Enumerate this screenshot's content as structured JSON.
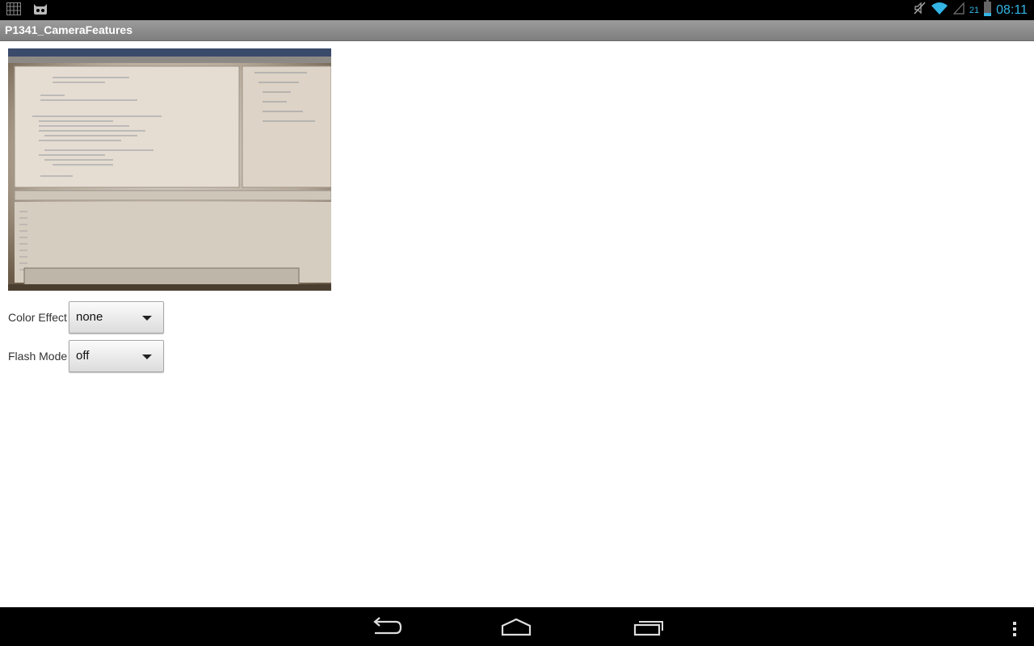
{
  "status_bar": {
    "icons_left": [
      "keyboard-grid-icon",
      "cyanogen-android-icon"
    ],
    "icons_right": [
      "mute-icon",
      "wifi-icon",
      "signal-icon",
      "battery-icon"
    ],
    "battery_level": "21",
    "time": "08:11",
    "accent_color": "#33b5e5"
  },
  "app": {
    "title": "P1341_CameraFeatures"
  },
  "camera_preview": {
    "description_icon": "camera-preview"
  },
  "controls": {
    "color_effect": {
      "label": "Color Effect",
      "value": "none"
    },
    "flash_mode": {
      "label": "Flash Mode",
      "value": "off"
    }
  },
  "nav_bar": {
    "buttons": [
      "back-icon",
      "home-icon",
      "recent-apps-icon",
      "overflow-menu-icon"
    ]
  }
}
